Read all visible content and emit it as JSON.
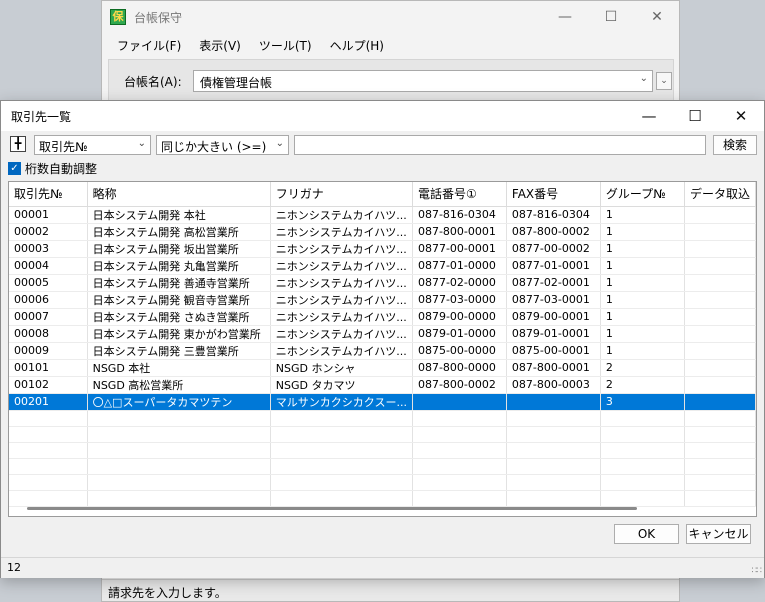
{
  "bg_window": {
    "title": "台帳保守",
    "icon_char": "保",
    "menus": [
      "ファイル(F)",
      "表示(V)",
      "ツール(T)",
      "ヘルプ(H)"
    ],
    "ledger_label": "台帳名(A):",
    "ledger_value": "債権管理台帳",
    "status": "請求先を入力します。"
  },
  "dialog": {
    "title": "取引先一覧",
    "field_select": "取引先№",
    "operator_select": "同じか大きい (>=)",
    "search_value": "",
    "search_button": "検索",
    "autofit_label": "桁数自動調整",
    "ok_label": "OK",
    "cancel_label": "キャンセル",
    "status_count": "12"
  },
  "table": {
    "headers": [
      "取引先№",
      "略称",
      "フリガナ",
      "電話番号①",
      "FAX番号",
      "グループ№",
      "データ取込"
    ],
    "rows": [
      [
        "00001",
        "日本システム開発 本社",
        "ニホンシステムカイハツ...",
        "087-816-0304",
        "087-816-0304",
        "1",
        ""
      ],
      [
        "00002",
        "日本システム開発 高松営業所",
        "ニホンシステムカイハツ...",
        "087-800-0001",
        "087-800-0002",
        "1",
        ""
      ],
      [
        "00003",
        "日本システム開発 坂出営業所",
        "ニホンシステムカイハツ...",
        "0877-00-0001",
        "0877-00-0002",
        "1",
        ""
      ],
      [
        "00004",
        "日本システム開発 丸亀営業所",
        "ニホンシステムカイハツ...",
        "0877-01-0000",
        "0877-01-0001",
        "1",
        ""
      ],
      [
        "00005",
        "日本システム開発 善通寺営業所",
        "ニホンシステムカイハツ...",
        "0877-02-0000",
        "0877-02-0001",
        "1",
        ""
      ],
      [
        "00006",
        "日本システム開発 観音寺営業所",
        "ニホンシステムカイハツ...",
        "0877-03-0000",
        "0877-03-0001",
        "1",
        ""
      ],
      [
        "00007",
        "日本システム開発 さぬき営業所",
        "ニホンシステムカイハツ...",
        "0879-00-0000",
        "0879-00-0001",
        "1",
        ""
      ],
      [
        "00008",
        "日本システム開発 東かがわ営業所",
        "ニホンシステムカイハツ...",
        "0879-01-0000",
        "0879-01-0001",
        "1",
        ""
      ],
      [
        "00009",
        "日本システム開発 三豊営業所",
        "ニホンシステムカイハツ...",
        "0875-00-0000",
        "0875-00-0001",
        "1",
        ""
      ],
      [
        "00101",
        "NSGD 本社",
        "NSGD ホンシャ",
        "087-800-0000",
        "087-800-0001",
        "2",
        ""
      ],
      [
        "00102",
        "NSGD 高松営業所",
        "NSGD タカマツ",
        "087-800-0002",
        "087-800-0003",
        "2",
        ""
      ],
      [
        "00201",
        "〇△□スーパータカマツテン",
        "マルサンカクシカクスー...",
        "",
        "",
        "3",
        ""
      ]
    ],
    "selected_row": 11
  }
}
